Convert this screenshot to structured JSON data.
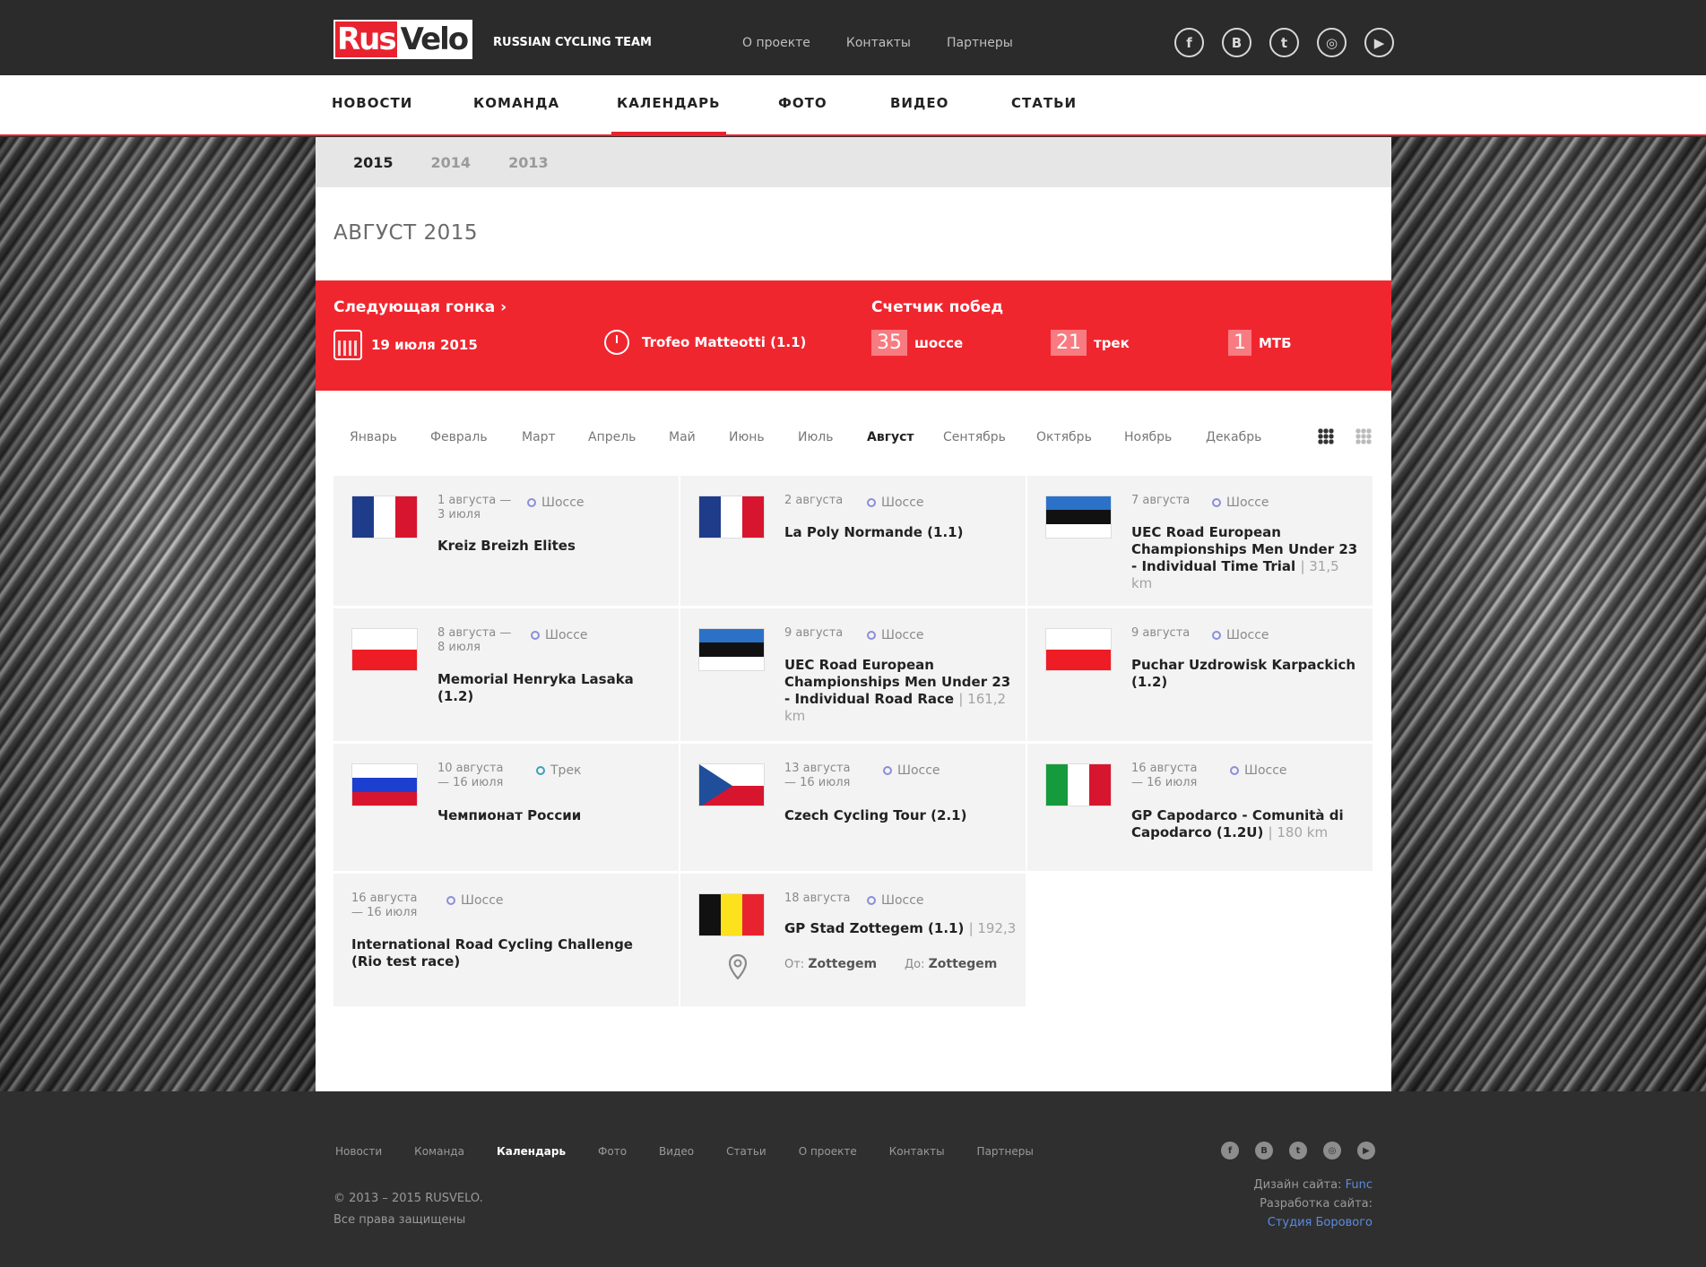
{
  "header": {
    "logo_rus": "Rus",
    "logo_velo": "Velo",
    "tagline": "RUSSIAN CYCLING TEAM",
    "links": [
      "О проекте",
      "Контакты",
      "Партнеры"
    ],
    "socials": [
      {
        "icon": "facebook-icon",
        "glyph": "f"
      },
      {
        "icon": "vk-icon",
        "glyph": "B"
      },
      {
        "icon": "twitter-icon",
        "glyph": "t"
      },
      {
        "icon": "instagram-icon",
        "glyph": "◎"
      },
      {
        "icon": "youtube-icon",
        "glyph": "▶"
      }
    ]
  },
  "nav": [
    "НОВОСТИ",
    "КОМАНДА",
    "КАЛЕНДАРЬ",
    "ФОТО",
    "ВИДЕО",
    "СТАТЬИ"
  ],
  "nav_active": "КАЛЕНДАРЬ",
  "years": [
    "2015",
    "2014",
    "2013"
  ],
  "year_active": "2015",
  "month_title": "АВГУСТ 2015",
  "next_race": {
    "label": "Следующая гонка ›",
    "date": "19 июля 2015",
    "name": "Trofeo Matteotti (1.1)"
  },
  "wins": {
    "label": "Счетчик побед",
    "items": [
      {
        "count": "35",
        "label": "шоссе"
      },
      {
        "count": "21",
        "label": "трек"
      },
      {
        "count": "1",
        "label": "МТБ"
      }
    ]
  },
  "months": [
    "Январь",
    "Февраль",
    "Март",
    "Апрель",
    "Май",
    "Июнь",
    "Июль",
    "Август",
    "Сентябрь",
    "Октябрь",
    "Ноябрь",
    "Декабрь"
  ],
  "month_active": "Август",
  "races": [
    {
      "flag": "france",
      "date": "1 августа — 3 июля",
      "type": "Шоссе",
      "title": "Kreiz Breizh Elites",
      "dist": ""
    },
    {
      "flag": "france",
      "date": "2 августа",
      "type": "Шоссе",
      "title": "La Poly Normande (1.1)",
      "dist": ""
    },
    {
      "flag": "estonia",
      "date": "7 августа",
      "type": "Шоссе",
      "title": "UEC Road European Championships Men Under 23 - Individual Time Trial",
      "dist": "| 31,5 km"
    },
    {
      "flag": "poland",
      "date": "8 августа — 8 июля",
      "type": "Шоссе",
      "title": "Memorial Henryka Lasaka (1.2)",
      "dist": ""
    },
    {
      "flag": "estonia",
      "date": "9 августа",
      "type": "Шоссе",
      "title": "UEC Road European Championships Men Under 23 - Individual Road Race",
      "dist": "| 161,2 km"
    },
    {
      "flag": "poland",
      "date": "9 августа",
      "type": "Шоссе",
      "title": "Puchar Uzdrowisk Karpackich (1.2)",
      "dist": ""
    },
    {
      "flag": "russia",
      "date": "10 августа — 16 июля",
      "type": "Трек",
      "title": "Чемпионат России",
      "dist": ""
    },
    {
      "flag": "czech",
      "date": "13 августа — 16 июля",
      "type": "Шоссе",
      "title": "Czech Cycling Tour (2.1)",
      "dist": ""
    },
    {
      "flag": "italy",
      "date": "16 августа — 16 июля",
      "type": "Шоссе",
      "title": "GP Capodarco - Comunità di Capodarco (1.2U)",
      "dist": "| 180 km"
    },
    {
      "flag": "",
      "date": "16 августа — 16 июля",
      "type": "Шоссе",
      "title": "International Road Cycling Challenge (Rio test race)",
      "dist": ""
    },
    {
      "flag": "belgium",
      "date": "18 августа",
      "type": "Шоссе",
      "title": "GP Stad Zottegem (1.1)",
      "dist": "| 192,3",
      "from_label": "От:",
      "from": "Zottegem",
      "to_label": "До:",
      "to": "Zottegem"
    }
  ],
  "footer": {
    "links": [
      "Новости",
      "Команда",
      "Календарь",
      "Фото",
      "Видео",
      "Статьи",
      "О проекте",
      "Контакты",
      "Партнеры"
    ],
    "active": "Календарь",
    "copyright": "© 2013 – 2015 RUSVELO.",
    "rights": "Все права защищены",
    "design_label": "Дизайн сайта:",
    "design_by": "Func",
    "dev_label": "Разработка сайта:",
    "dev_by": "Студия Борового"
  },
  "colors": {
    "accent": "#f0262f",
    "dark": "#2b2b2b",
    "card": "#f4f3f3"
  }
}
